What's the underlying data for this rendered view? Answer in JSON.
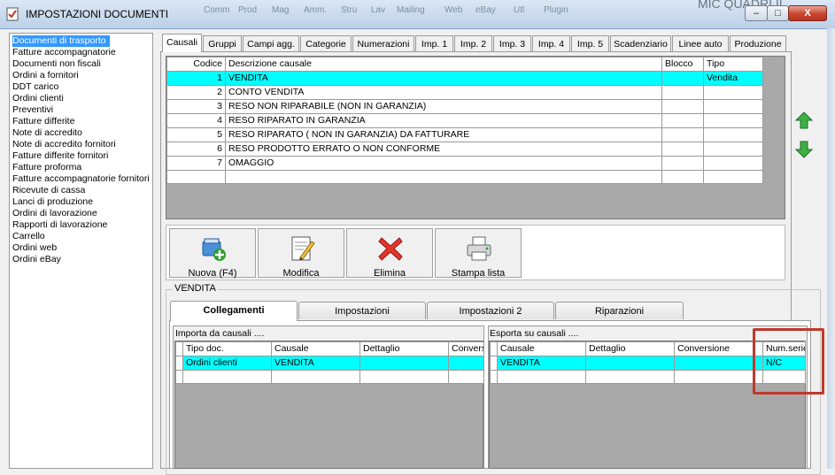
{
  "window": {
    "title": "IMPOSTAZIONI DOCUMENTI",
    "background_menu": [
      "Comm",
      "Prod",
      "Mag",
      "Amm.",
      "Stru",
      "Lav",
      "Mailing",
      "Web",
      "eBay",
      "Utl",
      "Plugin"
    ],
    "background_right_text": "MIC QUADRI II",
    "controls": {
      "minimize": "–",
      "maximize": "□",
      "close": "X"
    }
  },
  "doc_types": [
    "Documenti di trasporto",
    "Fatture accompagnatorie",
    "Documenti non fiscali",
    "Ordini a fornitori",
    "DDT carico",
    "Ordini clienti",
    "Preventivi",
    "Fatture differite",
    "Note di accredito",
    "Note di accredito fornitori",
    "Fatture differite fornitori",
    "Fatture proforma",
    "Fatture accompagnatorie fornitori",
    "Ricevute di cassa",
    "Lanci di produzione",
    "Ordini di lavorazione",
    "Rapporti di lavorazione",
    "Carrello",
    "Ordini web",
    "Ordini eBay"
  ],
  "selected_doc_type": "Documenti di trasporto",
  "tabs": [
    "Causali",
    "Gruppi",
    "Campi agg.",
    "Categorie",
    "Numerazioni",
    "Imp. 1",
    "Imp. 2",
    "Imp. 3",
    "Imp. 4",
    "Imp. 5",
    "Scadenziario",
    "Linee auto",
    "Produzione"
  ],
  "active_tab": "Causali",
  "causali_grid": {
    "columns": [
      "Codice",
      "Descrizione causale",
      "Blocco",
      "Tipo"
    ],
    "rows": [
      {
        "code": "1",
        "desc": "VENDITA",
        "block": "",
        "type": "Vendita"
      },
      {
        "code": "2",
        "desc": "CONTO VENDITA",
        "block": "",
        "type": ""
      },
      {
        "code": "3",
        "desc": "RESO NON RIPARABILE (NON IN GARANZIA)",
        "block": "",
        "type": ""
      },
      {
        "code": "4",
        "desc": "RESO RIPARATO IN GARANZIA",
        "block": "",
        "type": ""
      },
      {
        "code": "5",
        "desc": "RESO RIPARATO ( NON IN GARANZIA)  DA FATTURARE",
        "block": "",
        "type": ""
      },
      {
        "code": "6",
        "desc": "RESO PRODOTTO ERRATO O NON CONFORME",
        "block": "",
        "type": ""
      },
      {
        "code": "7",
        "desc": "OMAGGIO",
        "block": "",
        "type": ""
      },
      {
        "code": "",
        "desc": "",
        "block": "",
        "type": ""
      }
    ],
    "selected_row": 0
  },
  "toolbar": {
    "new_label": "Nuova (F4)",
    "edit_label": "Modifica",
    "delete_label": "Elimina",
    "print_label": "Stampa lista"
  },
  "group_title": "VENDITA",
  "sub_tabs": [
    "Collegamenti",
    "Impostazioni",
    "Impostazioni 2",
    "Riparazioni"
  ],
  "active_sub_tab": "Collegamenti",
  "import_panel": {
    "label": "Importa da causali ....",
    "columns": [
      "Tipo doc.",
      "Causale",
      "Dettaglio",
      "Conversione"
    ],
    "rows": [
      [
        "Ordini clienti",
        "VENDITA",
        "",
        ""
      ],
      [
        "",
        "",
        "",
        ""
      ]
    ]
  },
  "export_panel": {
    "label": "Esporta su causali ....",
    "columns": [
      "Causale",
      "Dettaglio",
      "Conversione",
      "Num.serie"
    ],
    "rows": [
      [
        "VENDITA",
        "",
        "",
        "N/C"
      ],
      [
        "",
        "",
        "",
        ""
      ]
    ]
  },
  "colors": {
    "selection_row": "#00ffff",
    "list_selection": "#3399ff",
    "arrow_green": "#2e9e2e",
    "highlight_annotation": "#c0392b"
  }
}
